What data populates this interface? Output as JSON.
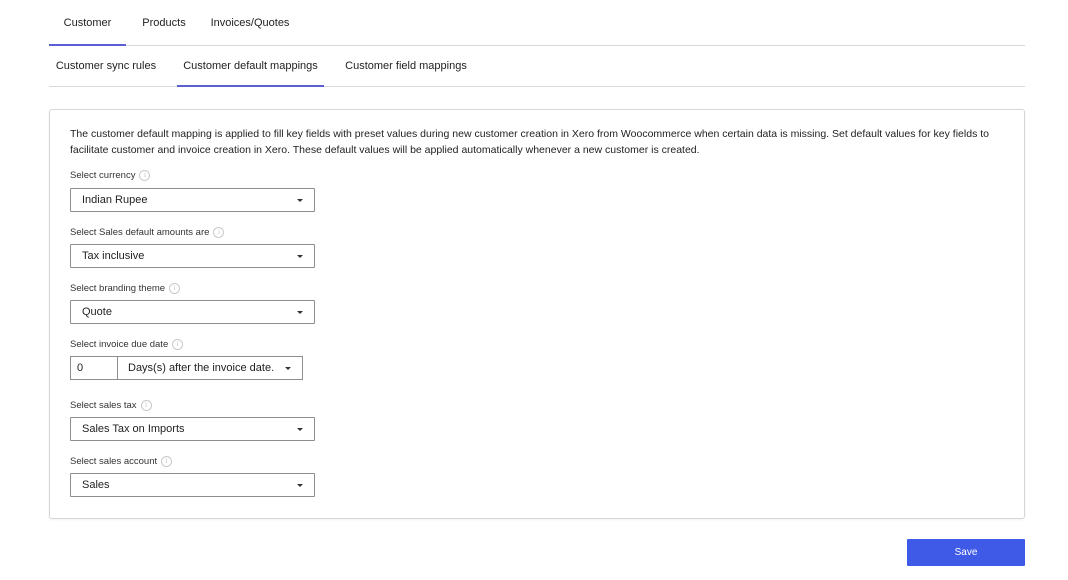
{
  "top_tabs": [
    {
      "label": "Customer",
      "active": true
    },
    {
      "label": "Products",
      "active": false
    },
    {
      "label": "Invoices/Quotes",
      "active": false
    }
  ],
  "sub_tabs": [
    {
      "label": "Customer sync rules",
      "active": false
    },
    {
      "label": "Customer default mappings",
      "active": true
    },
    {
      "label": "Customer field mappings",
      "active": false
    }
  ],
  "description": "The customer default mapping is applied to fill key fields with preset values during new customer creation in Xero from Woocommerce when certain data is missing. Set default values for key fields to facilitate customer and invoice creation in Xero. These default values will be applied automatically whenever a new customer is created.",
  "fields": {
    "currency": {
      "label": "Select currency",
      "value": "Indian Rupee"
    },
    "sales_amounts": {
      "label": "Select Sales default amounts are",
      "value": "Tax inclusive"
    },
    "branding_theme": {
      "label": "Select branding theme",
      "value": "Quote"
    },
    "invoice_due_date": {
      "label": "Select invoice due date",
      "days_value": "0",
      "value": "Days(s) after the invoice date."
    },
    "sales_tax": {
      "label": "Select sales tax",
      "value": "Sales Tax on Imports"
    },
    "sales_account": {
      "label": "Select sales account",
      "value": "Sales"
    }
  },
  "info_icon_glyph": "i",
  "save_label": "Save",
  "colors": {
    "accent": "#5b5fd6",
    "button": "#3e5ae6"
  }
}
